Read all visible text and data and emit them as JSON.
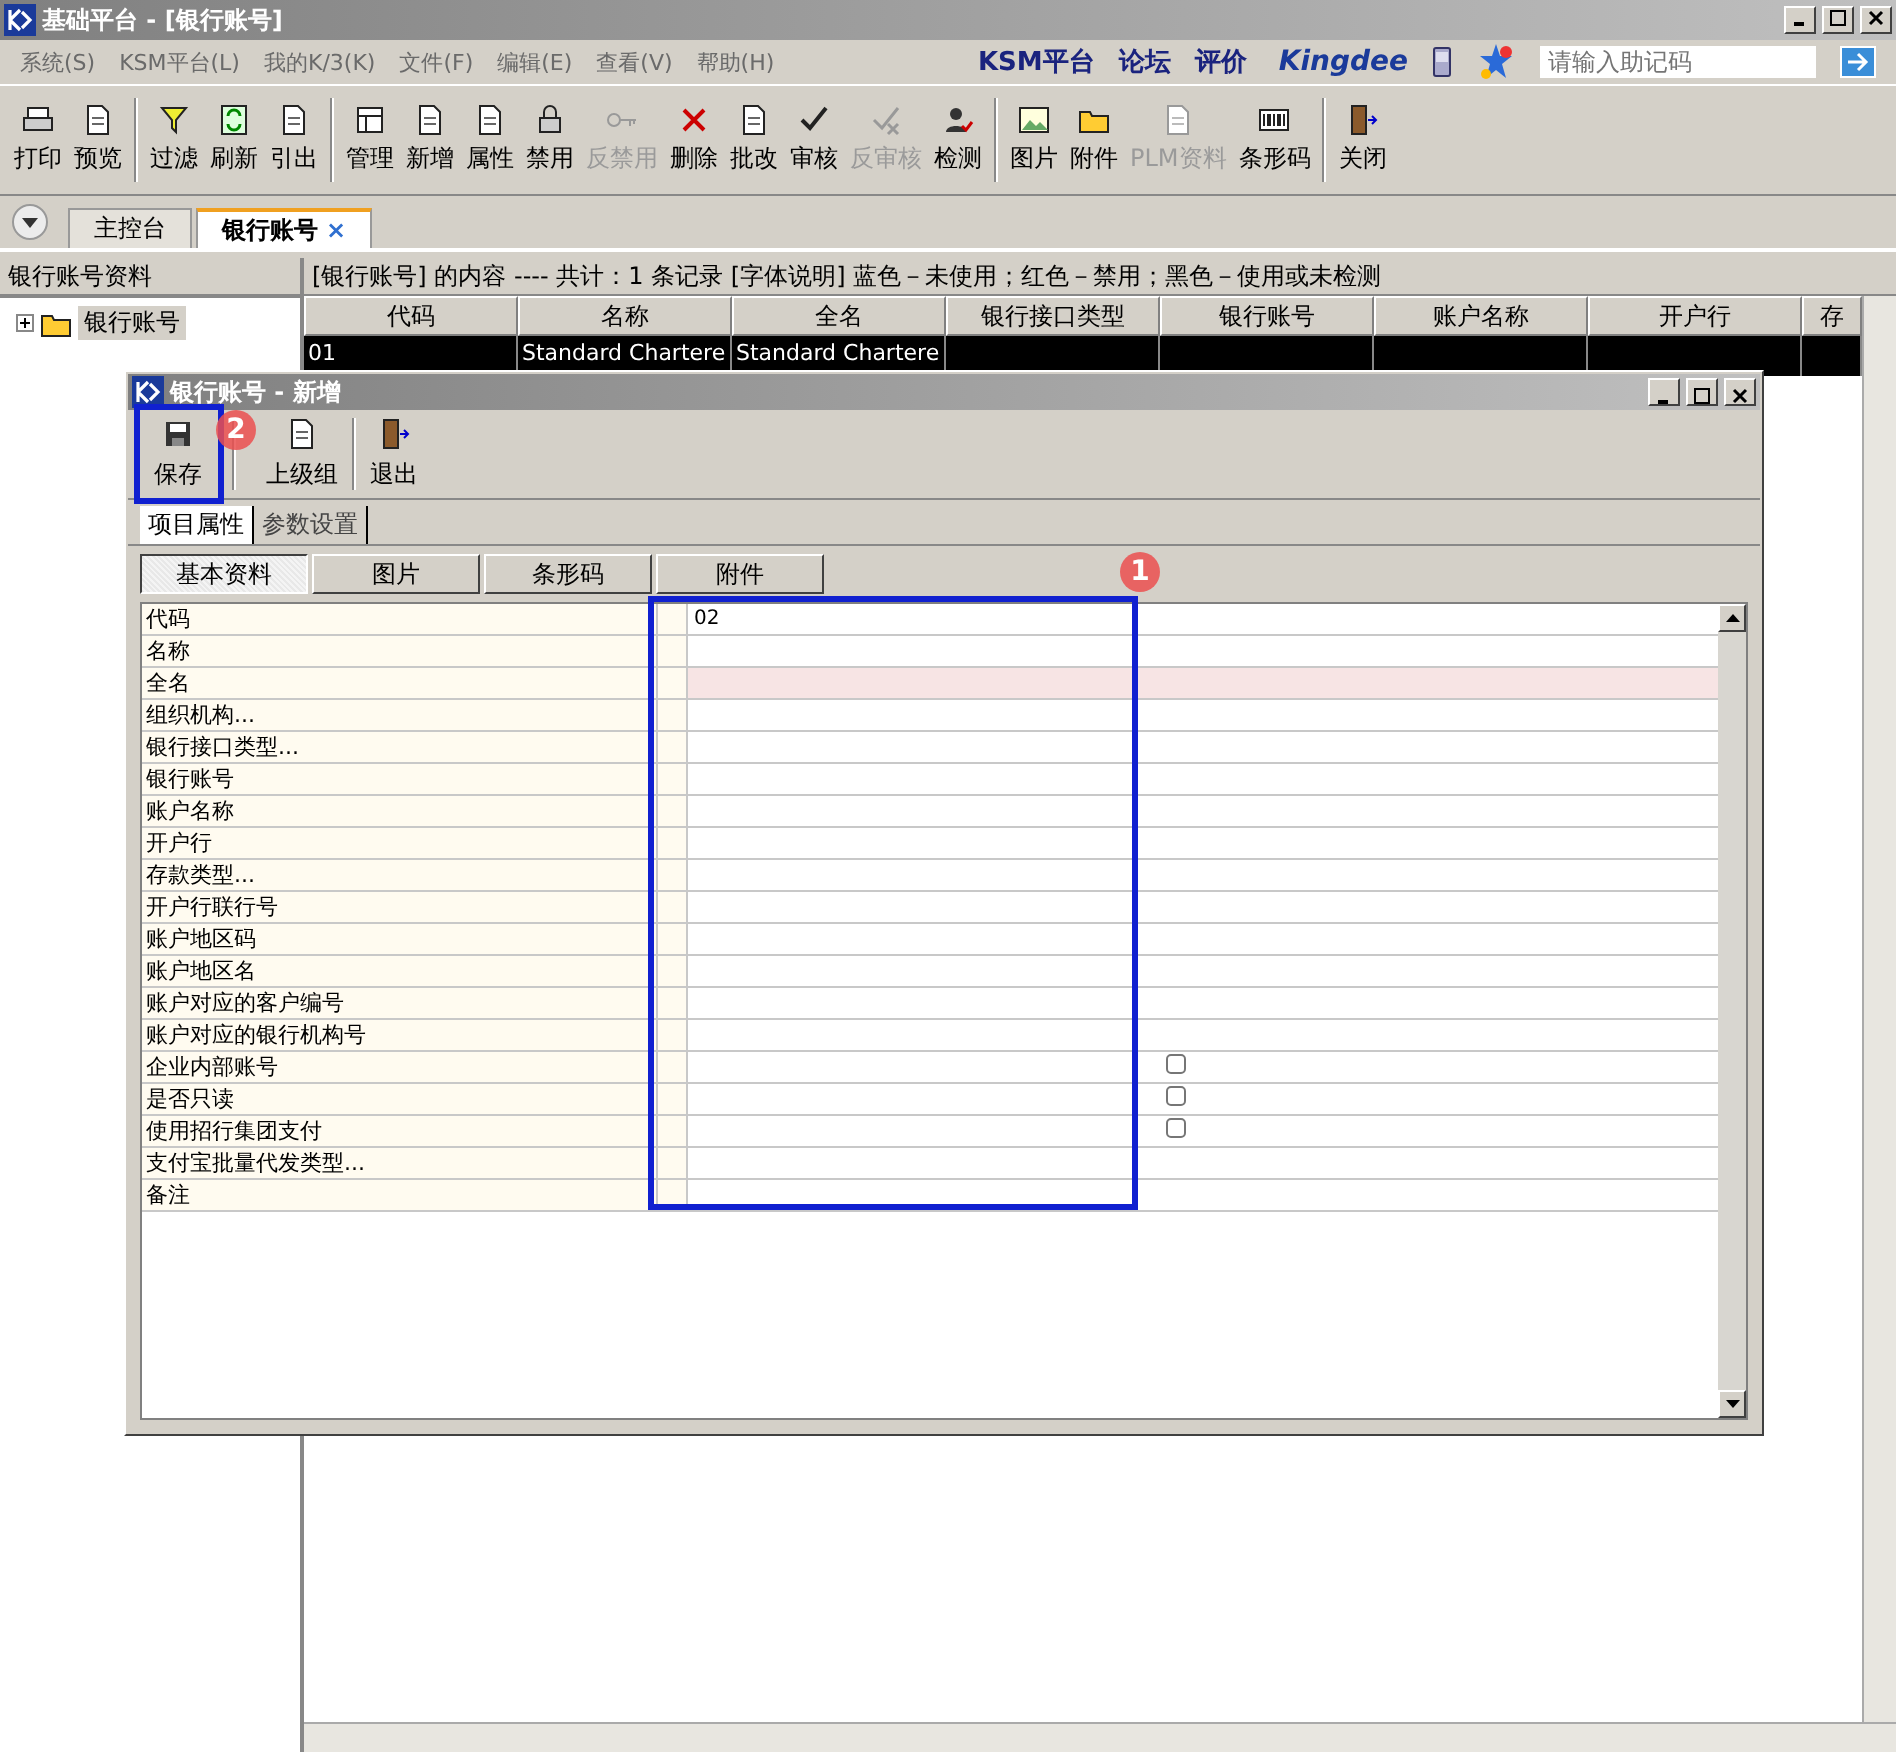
{
  "window": {
    "title": "基础平台 - [银行账号]"
  },
  "menu": [
    "系统(S)",
    "KSM平台(L)",
    "我的K/3(K)",
    "文件(F)",
    "编辑(E)",
    "查看(V)",
    "帮助(H)"
  ],
  "top_links": [
    "KSM平台",
    "论坛",
    "评价"
  ],
  "brand": "Kingdee",
  "search": {
    "placeholder": "请输入助记码"
  },
  "toolbar": [
    {
      "label": "打印",
      "disabled": false
    },
    {
      "label": "预览",
      "disabled": false,
      "group_end": true
    },
    {
      "label": "过滤",
      "disabled": false
    },
    {
      "label": "刷新",
      "disabled": false
    },
    {
      "label": "引出",
      "disabled": false,
      "group_end": true
    },
    {
      "label": "管理",
      "disabled": false
    },
    {
      "label": "新增",
      "disabled": false
    },
    {
      "label": "属性",
      "disabled": false
    },
    {
      "label": "禁用",
      "disabled": false
    },
    {
      "label": "反禁用",
      "disabled": true
    },
    {
      "label": "删除",
      "disabled": false
    },
    {
      "label": "批改",
      "disabled": false
    },
    {
      "label": "审核",
      "disabled": false
    },
    {
      "label": "反审核",
      "disabled": true
    },
    {
      "label": "检测",
      "disabled": false,
      "group_end": true
    },
    {
      "label": "图片",
      "disabled": false
    },
    {
      "label": "附件",
      "disabled": false
    },
    {
      "label": "PLM资料",
      "disabled": true
    },
    {
      "label": "条形码",
      "disabled": false,
      "group_end": true
    },
    {
      "label": "关闭",
      "disabled": false
    }
  ],
  "tabs": [
    {
      "label": "主控台",
      "selected": false,
      "closable": false
    },
    {
      "label": "银行账号",
      "selected": true,
      "closable": true
    }
  ],
  "tab_close": "×",
  "sidebar": {
    "title": "银行账号资料",
    "items": [
      {
        "label": "银行账号",
        "selected": true,
        "expanded": false
      }
    ]
  },
  "list": {
    "info": "[银行账号] 的内容 ---- 共计：1 条记录  [字体说明] 蓝色－未使用；红色－禁用；黑色－使用或未检测",
    "columns": [
      "代码",
      "名称",
      "全名",
      "银行接口类型",
      "银行账号",
      "账户名称",
      "开户行",
      "存"
    ],
    "rows": [
      {
        "cells": [
          "01",
          "Standard Chartere",
          "Standard Chartere",
          "",
          "",
          "",
          "",
          ""
        ],
        "selected": true
      }
    ]
  },
  "dialog": {
    "title": "银行账号 - 新增",
    "toolbar": [
      "保存",
      "上级组",
      "退出"
    ],
    "tabs": [
      {
        "label": "项目属性",
        "selected": true
      },
      {
        "label": "参数设置",
        "selected": false
      }
    ],
    "subtabs": [
      {
        "label": "基本资料",
        "selected": true
      },
      {
        "label": "图片",
        "selected": false
      },
      {
        "label": "条形码",
        "selected": false
      },
      {
        "label": "附件",
        "selected": false
      }
    ],
    "fields": [
      {
        "label": "代码",
        "kind": "text",
        "value": "02",
        "required": false
      },
      {
        "label": "名称",
        "kind": "text",
        "required": false
      },
      {
        "label": "全名",
        "kind": "text",
        "required": true
      },
      {
        "label": "组织机构...",
        "kind": "text",
        "required": false
      },
      {
        "label": "银行接口类型...",
        "kind": "text",
        "required": false
      },
      {
        "label": "银行账号",
        "kind": "text",
        "required": false
      },
      {
        "label": "账户名称",
        "kind": "text",
        "required": false
      },
      {
        "label": "开户行",
        "kind": "text",
        "required": false
      },
      {
        "label": "存款类型...",
        "kind": "text",
        "required": false
      },
      {
        "label": "开户行联行号",
        "kind": "text",
        "required": false
      },
      {
        "label": "账户地区码",
        "kind": "text",
        "required": false
      },
      {
        "label": "账户地区名",
        "kind": "text",
        "required": false
      },
      {
        "label": "账户对应的客户编号",
        "kind": "text",
        "required": false
      },
      {
        "label": "账户对应的银行机构号",
        "kind": "text",
        "required": false
      },
      {
        "label": "企业内部账号",
        "kind": "checkbox",
        "checked": false
      },
      {
        "label": "是否只读",
        "kind": "checkbox",
        "checked": false
      },
      {
        "label": "使用招行集团支付",
        "kind": "checkbox",
        "checked": false
      },
      {
        "label": "支付宝批量代发类型...",
        "kind": "text",
        "required": false
      },
      {
        "label": "备注",
        "kind": "text",
        "required": false
      }
    ]
  },
  "annotations": [
    {
      "number": "1"
    },
    {
      "number": "2"
    }
  ]
}
